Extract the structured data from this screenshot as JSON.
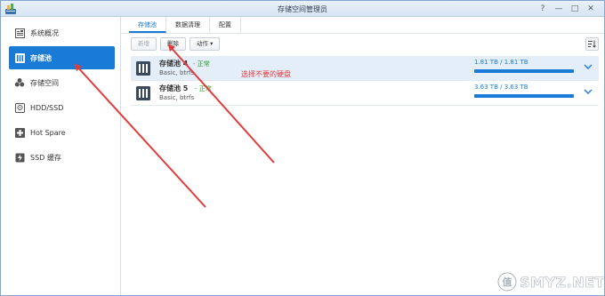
{
  "window": {
    "title": "存储空间管理员",
    "controls": [
      "?",
      "—",
      "□",
      "✕"
    ]
  },
  "sidebar": {
    "items": [
      {
        "label": "系统概况",
        "icon": "overview-icon",
        "active": false
      },
      {
        "label": "存储池",
        "icon": "storage-pool-icon",
        "active": true
      },
      {
        "label": "存储空间",
        "icon": "volume-icon",
        "active": false
      },
      {
        "label": "HDD/SSD",
        "icon": "hdd-icon",
        "active": false
      },
      {
        "label": "Hot Spare",
        "icon": "hot-spare-icon",
        "active": false
      },
      {
        "label": "SSD 缓存",
        "icon": "ssd-cache-icon",
        "active": false
      }
    ]
  },
  "tabs": [
    {
      "label": "存储池",
      "active": true
    },
    {
      "label": "数据清理",
      "active": false
    },
    {
      "label": "配置",
      "active": false
    }
  ],
  "toolbar": {
    "new_label": "新增",
    "delete_label": "删除",
    "action_label": "动作 ▾"
  },
  "pools": [
    {
      "name": "存储池 4",
      "status": "- 正常",
      "sub": "Basic, btrfs",
      "capacity": "1.81 TB / 1.81 TB",
      "used_fraction": 1.0,
      "selected": true
    },
    {
      "name": "存储池 5",
      "status": "- 正常",
      "sub": "Basic, btrfs",
      "capacity": "3.63 TB / 3.63 TB",
      "used_fraction": 1.0,
      "selected": false
    }
  ],
  "annotation": "选择不要的硬盘",
  "watermark": "SMYZ.NET",
  "colors": {
    "accent": "#1a7bd6",
    "status_ok": "#2a9d2a",
    "annotation": "#e23b3b"
  }
}
